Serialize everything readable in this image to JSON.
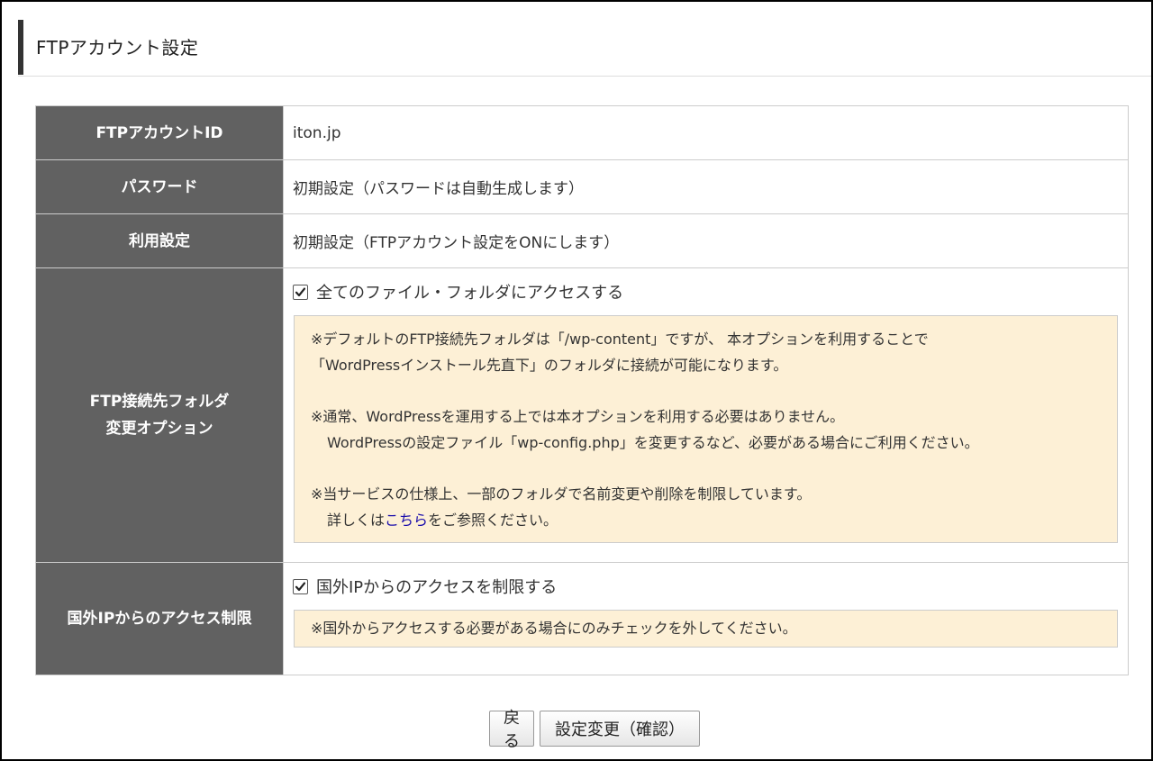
{
  "header": {
    "title": "FTPアカウント設定"
  },
  "rows": {
    "account_id": {
      "label": "FTPアカウントID",
      "value": "iton.jp"
    },
    "password": {
      "label": "パスワード",
      "value": "初期設定（パスワードは自動生成します）"
    },
    "usage": {
      "label": "利用設定",
      "value": "初期設定（FTPアカウント設定をONにします）"
    },
    "folder": {
      "label_line1": "FTP接続先フォルダ",
      "label_line2": "変更オプション",
      "checkbox_label": "全てのファイル・フォルダにアクセスする",
      "checked": true,
      "note": {
        "p1_line1": "※デフォルトのFTP接続先フォルダは「/wp-content」ですが、 本オプションを利用することで",
        "p1_line2": "「WordPressインストール先直下」のフォルダに接続が可能になります。",
        "p2_line1": "※通常、WordPressを運用する上では本オプションを利用する必要はありません。",
        "p2_line2": "WordPressの設定ファイル「wp-config.php」を変更するなど、必要がある場合にご利用ください。",
        "p3_line1": "※当サービスの仕様上、一部のフォルダで名前変更や削除を制限しています。",
        "p3_line2_prefix": "詳しくは",
        "p3_link": "こちら",
        "p3_line2_suffix": "をご参照ください。"
      }
    },
    "foreign_ip": {
      "label": "国外IPからのアクセス制限",
      "checkbox_label": "国外IPからのアクセスを制限する",
      "checked": true,
      "note": "※国外からアクセスする必要がある場合にのみチェックを外してください。"
    }
  },
  "buttons": {
    "back": "戻る",
    "confirm": "設定変更（確認）"
  },
  "colors": {
    "header_cell": "#616161",
    "note_bg": "#fdf0d6",
    "link": "#1a0dab"
  }
}
